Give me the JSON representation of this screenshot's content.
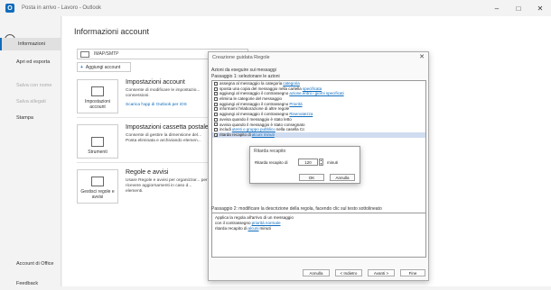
{
  "window": {
    "title": "Posta in arrivo - Lavoro - Outlook",
    "app_letter": "O",
    "controls": [
      "–",
      "□",
      "✕"
    ]
  },
  "sidebar": {
    "back_icon": "←",
    "items": [
      {
        "label": "Informazioni",
        "active": true
      },
      {
        "label": "Apri ed esporta"
      },
      {
        "label": "Salva con nome",
        "disabled": true
      },
      {
        "label": "Salva allegati",
        "disabled": true
      },
      {
        "label": "Stampa"
      }
    ],
    "bottom_items": [
      {
        "label": "Account di Office"
      },
      {
        "label": "Feedback"
      }
    ]
  },
  "main": {
    "title": "Informazioni account",
    "account_type": "IMAP/SMTP",
    "add_account_label": "Aggiungi account",
    "sections": [
      {
        "tile_label": "Impostazioni account",
        "title": "Impostazioni account",
        "desc": "Consente di modificare le impostazio... connessioni.",
        "link": "Scarica l'app di Outlook per iOS"
      },
      {
        "tile_label": "Strumenti",
        "title": "Impostazioni cassetta postale",
        "desc": "Consente di gestire la dimensione del... Posta eliminata e archiviando elemen..."
      },
      {
        "tile_label": "Gestisci regole e avvisi",
        "title": "Regole e avvisi",
        "desc": "Usare Regole e avvisi per organizzar... per ricevere aggiornamenti in caso d... elementi."
      }
    ]
  },
  "rules_wizard": {
    "title": "Creazione guidata Regole",
    "close_icon": "✕",
    "step1_heading": "Azioni da eseguire sui messaggi",
    "step1_sub": "Passaggio 1: selezionare le azioni",
    "actions": [
      {
        "text": "assegna al messaggio la categoria",
        "link": "categoria",
        "checked": false
      },
      {
        "text": "sposta una copia del messaggio nella cartella",
        "link": "specificata",
        "checked": false
      },
      {
        "text": "aggiungi al messaggio il contrassegno",
        "link": "azione entro i giorni specificati",
        "checked": false
      },
      {
        "text": "elimina le categorie del messaggio",
        "checked": false
      },
      {
        "text": "aggiungi al messaggio il contrassegno",
        "link": "Priorità",
        "checked": false
      },
      {
        "text": "informami l'elaborazione di altre regole",
        "checked": false
      },
      {
        "text": "aggiungi al messaggio il contrassegno",
        "link": "Riservatezza",
        "checked": false
      },
      {
        "text": "avvisa quando il messaggio è stato letto",
        "checked": false
      },
      {
        "text": "avvisa quando il messaggio è stato consegnato",
        "checked": false
      },
      {
        "text": "includi",
        "link": "utenti o gruppo pubblico",
        "tail": "nella casella Cc",
        "checked": false
      },
      {
        "text": "ritarda recapito di",
        "link": "alcuni minuti",
        "checked": true,
        "selected": true
      }
    ],
    "step2_label": "Passaggio 2: modificare la descrizione della regola, facendo clic sul testo sottolineato",
    "description_lines": [
      {
        "text": "Applica la regola all'arrivo di un messaggio"
      },
      {
        "text": "con il contrassegno",
        "link": "priorità normale"
      },
      {
        "text": "ritarda recapito di",
        "link": "alcuni",
        "tail": "minuti"
      }
    ],
    "buttons": {
      "cancel": "Annulla",
      "back": "< Indietro",
      "next": "Avanti >",
      "finish": "Fine"
    }
  },
  "delay_dialog": {
    "title": "Ritarda recapito",
    "label": "Ritarda recapito di",
    "value": "120",
    "unit": "minuti",
    "ok": "OK",
    "cancel": "Annulla"
  }
}
